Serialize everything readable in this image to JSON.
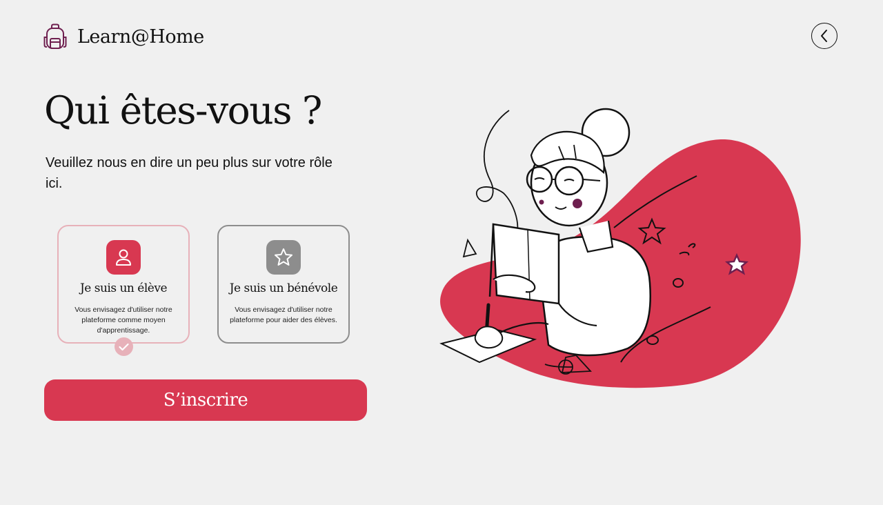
{
  "app": {
    "name": "Learn@Home"
  },
  "header": {
    "back_icon": "chevron-left-icon"
  },
  "main": {
    "title": "Qui êtes-vous ?",
    "subtitle": "Veuillez nous en dire un peu plus sur votre rôle ici.",
    "roles": [
      {
        "icon": "user-icon",
        "title": "Je suis un élève",
        "description": "Vous envisagez d'utiliser notre plateforme comme moyen d'apprentissage.",
        "selected": true
      },
      {
        "icon": "star-icon",
        "title": "Je suis un bénévole",
        "description": "Vous envisagez d'utiliser notre plateforme pour aider des élèves.",
        "selected": false
      }
    ],
    "submit_label": "S’inscrire"
  },
  "colors": {
    "accent": "#d83851",
    "accent_light": "#e7b1b9",
    "neutral": "#8d8d8d",
    "background": "#f0f0f0",
    "logo": "#6e1f4f"
  }
}
